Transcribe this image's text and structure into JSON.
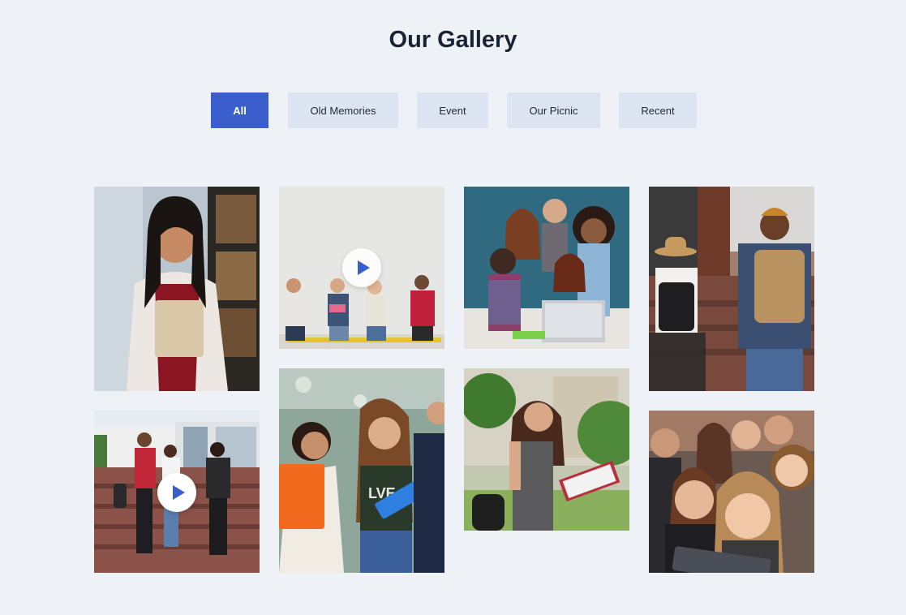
{
  "gallery": {
    "title": "Our Gallery",
    "filters": [
      {
        "label": "All",
        "active": true
      },
      {
        "label": "Old Memories",
        "active": false
      },
      {
        "label": "Event",
        "active": false
      },
      {
        "label": "Our Picnic",
        "active": false
      },
      {
        "label": "Recent",
        "active": false
      }
    ]
  },
  "colors": {
    "background": "#eef1f6",
    "accent": "#3a5fcd",
    "filter_bg": "#dce5f1",
    "title": "#1a2333"
  },
  "tiles": [
    {
      "icon": "photo-library-student",
      "has_video": false
    },
    {
      "icon": "photo-group-discussion",
      "has_video": true,
      "play_icon": "play-icon"
    },
    {
      "icon": "photo-students-laptop",
      "has_video": false
    },
    {
      "icon": "photo-students-backpacks",
      "has_video": false
    },
    {
      "icon": "photo-students-stairs",
      "has_video": true,
      "play_icon": "play-icon"
    },
    {
      "icon": "photo-friends-laughing",
      "has_video": false
    },
    {
      "icon": "photo-student-writing",
      "has_video": false
    },
    {
      "icon": "photo-group-selfie",
      "has_video": false
    }
  ]
}
